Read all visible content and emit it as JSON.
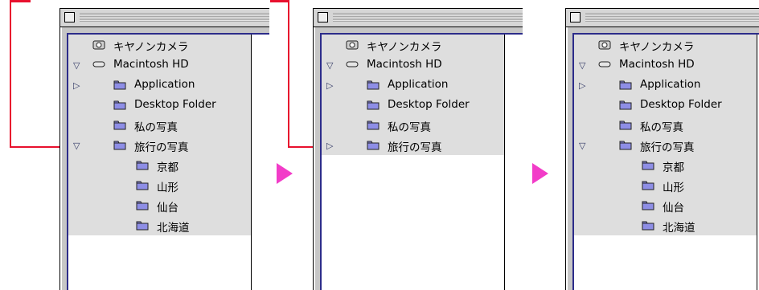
{
  "panels": [
    {
      "id": "before",
      "rows": [
        {
          "label": "キヤノンカメラ",
          "icon": "camera-icon",
          "disclosure": "none",
          "level": 0
        },
        {
          "label": "Macintosh HD",
          "icon": "hard-disk-icon",
          "disclosure": "expanded",
          "level": 0
        },
        {
          "label": "Application",
          "icon": "folder-icon",
          "disclosure": "collapsed",
          "level": 1
        },
        {
          "label": "Desktop Folder",
          "icon": "folder-icon",
          "disclosure": "none",
          "level": 1
        },
        {
          "label": "私の写真",
          "icon": "folder-icon",
          "disclosure": "none",
          "level": 1
        },
        {
          "label": "旅行の写真",
          "icon": "folder-icon",
          "disclosure": "expanded",
          "level": 1
        },
        {
          "label": "京都",
          "icon": "folder-icon",
          "disclosure": "none",
          "level": 2
        },
        {
          "label": "山形",
          "icon": "folder-icon",
          "disclosure": "none",
          "level": 2
        },
        {
          "label": "仙台",
          "icon": "folder-icon",
          "disclosure": "none",
          "level": 2
        },
        {
          "label": "北海道",
          "icon": "folder-icon",
          "disclosure": "none",
          "level": 2
        }
      ]
    },
    {
      "id": "collapsed",
      "rows": [
        {
          "label": "キヤノンカメラ",
          "icon": "camera-icon",
          "disclosure": "none",
          "level": 0
        },
        {
          "label": "Macintosh HD",
          "icon": "hard-disk-icon",
          "disclosure": "expanded",
          "level": 0
        },
        {
          "label": "Application",
          "icon": "folder-icon",
          "disclosure": "collapsed",
          "level": 1
        },
        {
          "label": "Desktop Folder",
          "icon": "folder-icon",
          "disclosure": "none",
          "level": 1
        },
        {
          "label": "私の写真",
          "icon": "folder-icon",
          "disclosure": "none",
          "level": 1
        },
        {
          "label": "旅行の写真",
          "icon": "folder-icon",
          "disclosure": "collapsed",
          "level": 1
        }
      ]
    },
    {
      "id": "expanded-again",
      "rows": [
        {
          "label": "キヤノンカメラ",
          "icon": "camera-icon",
          "disclosure": "none",
          "level": 0
        },
        {
          "label": "Macintosh HD",
          "icon": "hard-disk-icon",
          "disclosure": "expanded",
          "level": 0
        },
        {
          "label": "Application",
          "icon": "folder-icon",
          "disclosure": "collapsed",
          "level": 1
        },
        {
          "label": "Desktop Folder",
          "icon": "folder-icon",
          "disclosure": "none",
          "level": 1
        },
        {
          "label": "私の写真",
          "icon": "folder-icon",
          "disclosure": "none",
          "level": 1
        },
        {
          "label": "旅行の写真",
          "icon": "folder-icon",
          "disclosure": "expanded",
          "level": 1
        },
        {
          "label": "京都",
          "icon": "folder-icon",
          "disclosure": "none",
          "level": 2
        },
        {
          "label": "山形",
          "icon": "folder-icon",
          "disclosure": "none",
          "level": 2
        },
        {
          "label": "仙台",
          "icon": "folder-icon",
          "disclosure": "none",
          "level": 2
        },
        {
          "label": "北海道",
          "icon": "folder-icon",
          "disclosure": "none",
          "level": 2
        }
      ]
    }
  ],
  "colors": {
    "callout": "#e8102e",
    "step_arrow": "#f23cc8",
    "row_bg": "#dedede",
    "folder": "#8e8ee6"
  },
  "icons": {
    "disclosure_expanded": "▽",
    "disclosure_collapsed": "▷"
  }
}
